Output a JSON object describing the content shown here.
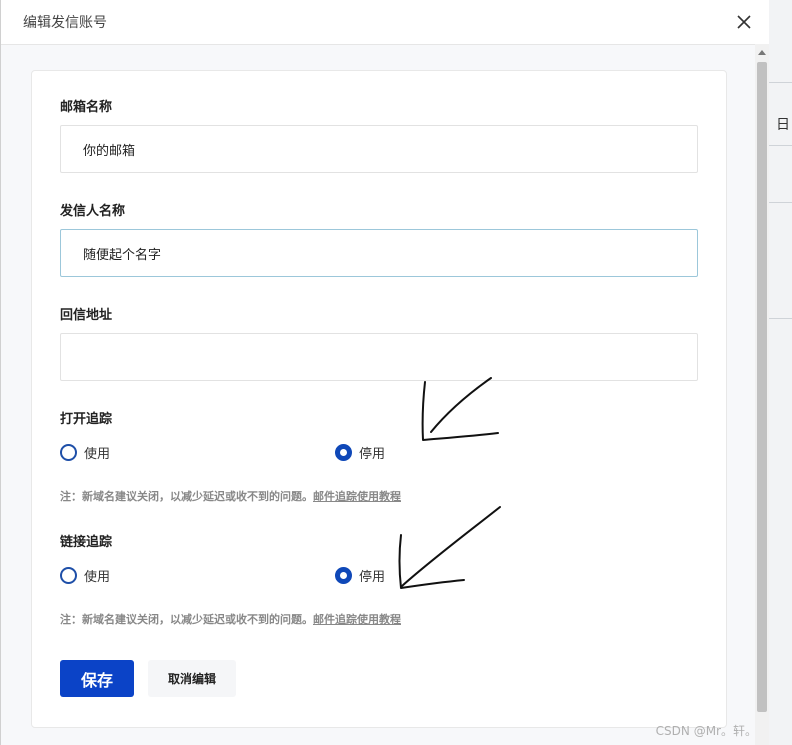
{
  "dialog": {
    "title": "编辑发信账号"
  },
  "form": {
    "mailbox_name": {
      "label": "邮箱名称",
      "value": "你的邮箱"
    },
    "sender_name": {
      "label": "发信人名称",
      "value": "随便起个名字"
    },
    "reply_address": {
      "label": "回信地址",
      "value": ""
    },
    "open_tracking": {
      "label": "打开追踪",
      "options": [
        "使用",
        "停用"
      ],
      "selected": "停用"
    },
    "link_tracking": {
      "label": "链接追踪",
      "options": [
        "使用",
        "停用"
      ],
      "selected": "停用"
    },
    "note_text": "注：新域名建议关闭，以减少延迟或收不到的问题。",
    "note_link": "邮件追踪使用教程"
  },
  "buttons": {
    "save": "保存",
    "cancel": "取消编辑"
  },
  "background": {
    "partial_glyph": "日"
  },
  "watermark": "CSDN @Mr。轩。",
  "colors": {
    "primary": "#0b43c7",
    "annotation_ink": "#111111"
  }
}
